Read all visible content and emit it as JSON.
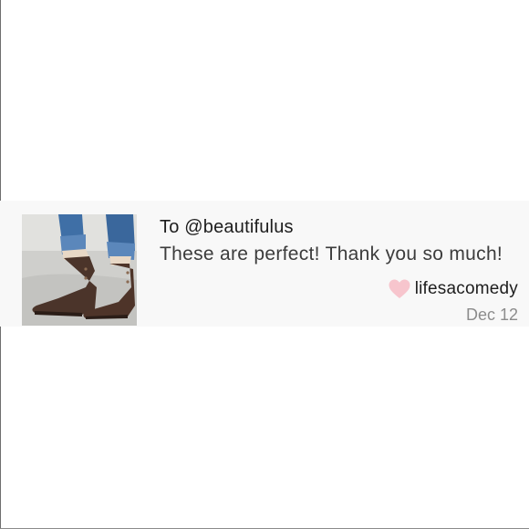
{
  "comment": {
    "recipient": "To @beautifulus",
    "message": "These are perfect! Thank you so much!",
    "author": "lifesacomedy",
    "date": "Dec 12",
    "heart_icon": "heart-icon",
    "heart_color": "#f7c5cd",
    "background": "#f8f8f8"
  },
  "thumbnail": {
    "subject": "photo of brown ankle boots with cuffed blue jeans"
  }
}
